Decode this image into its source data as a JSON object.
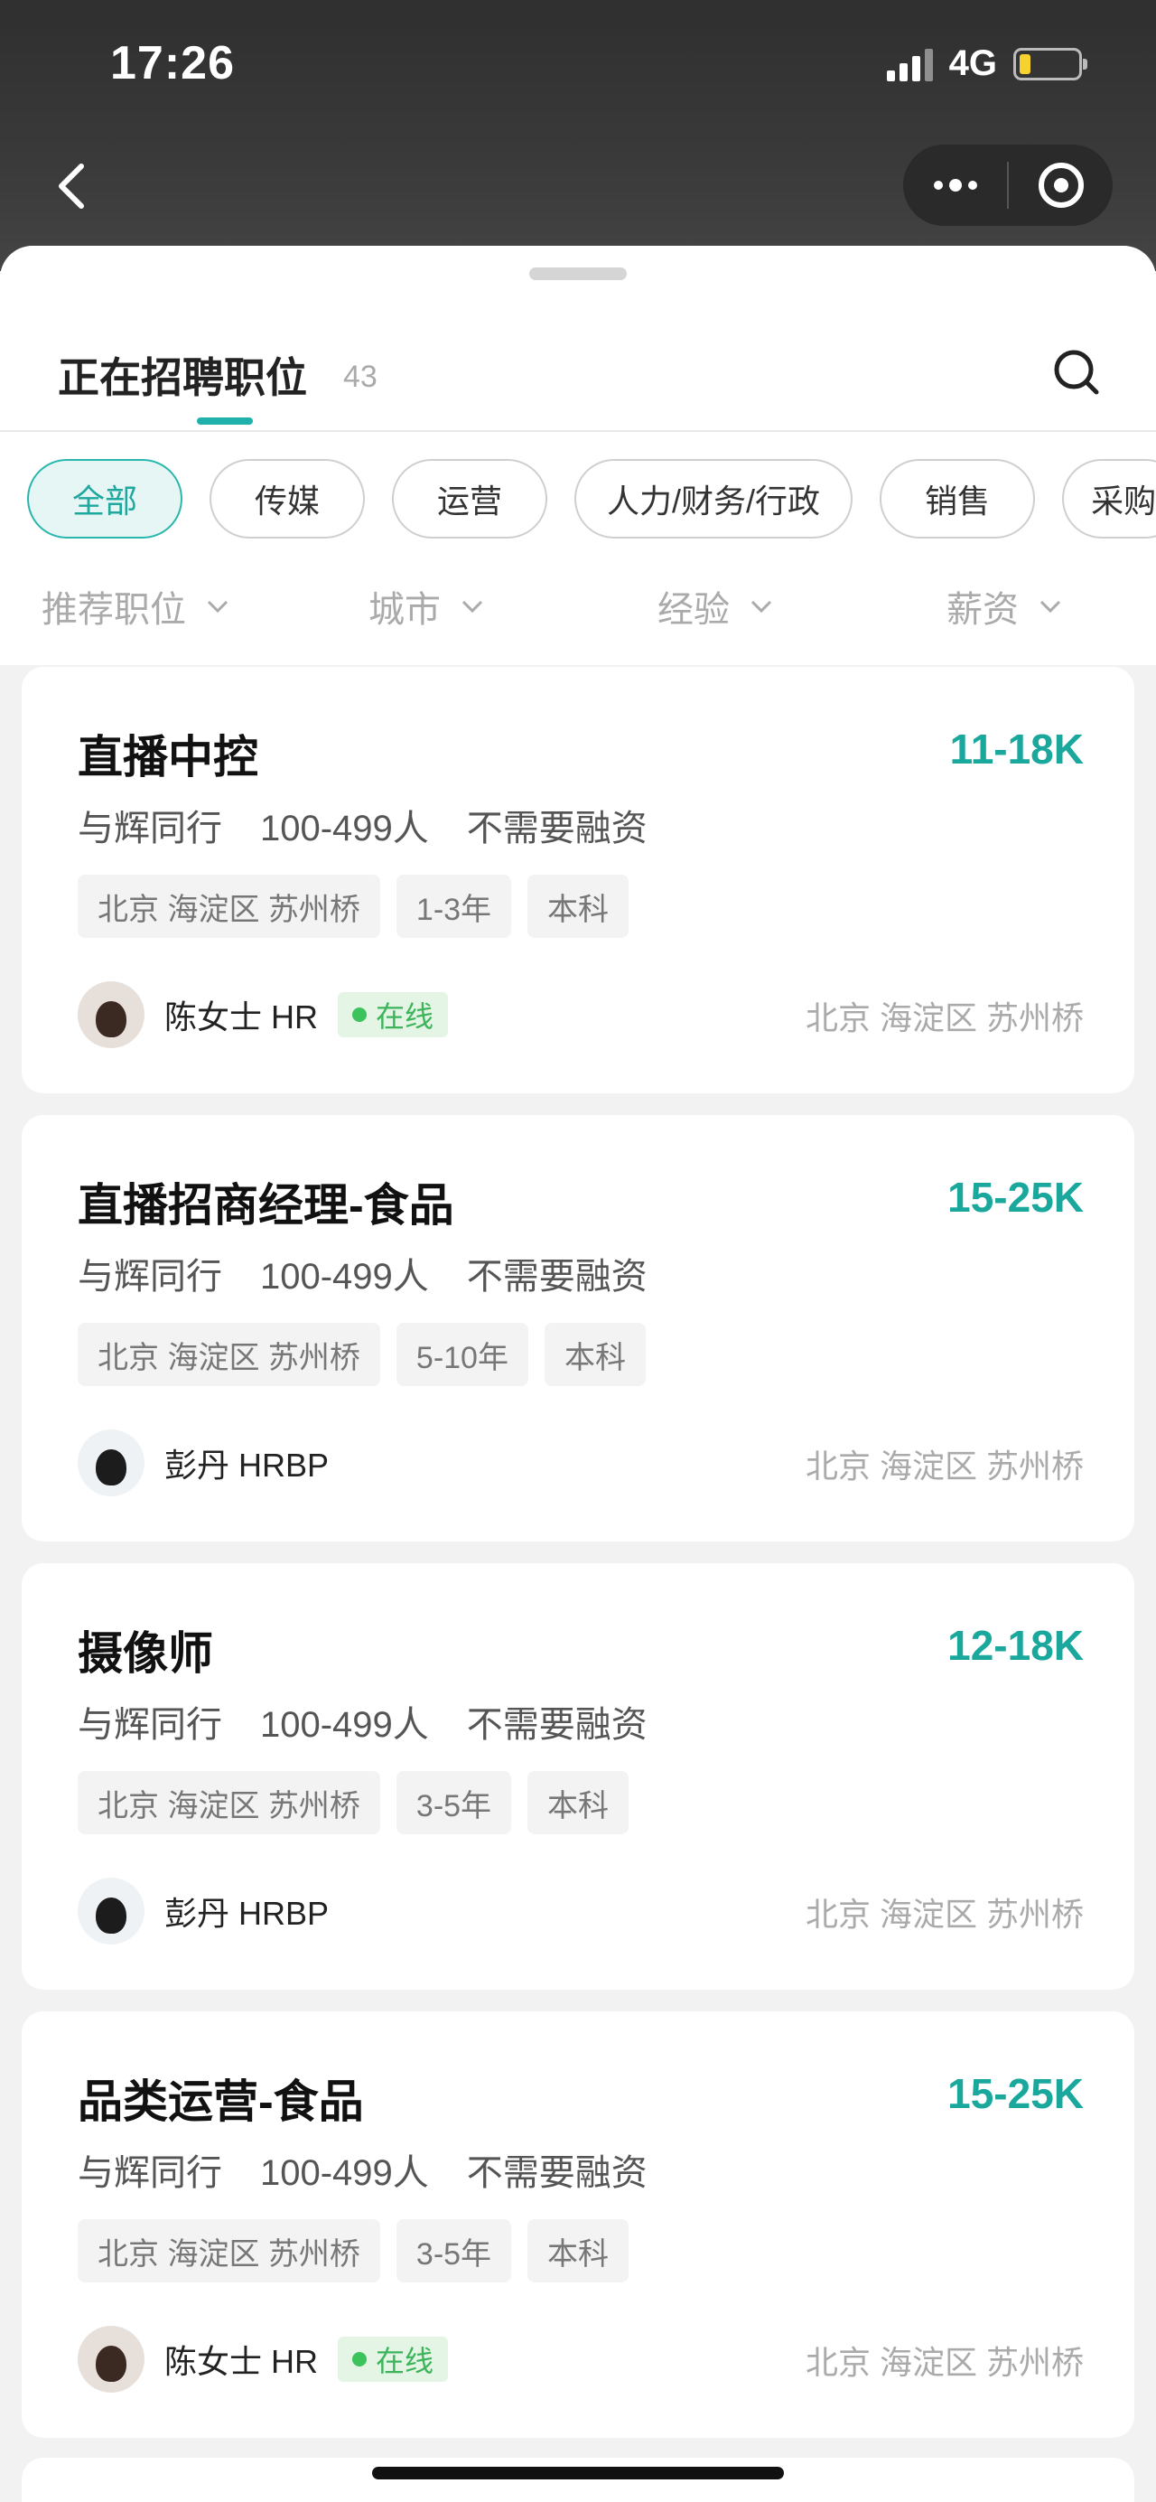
{
  "status_bar": {
    "time": "17:26",
    "network": "4G",
    "battery_level": 0.2
  },
  "header": {
    "title": "正在招聘职位",
    "count": "43"
  },
  "categories": {
    "items": [
      "全部",
      "传媒",
      "运营",
      "人力/财务/行政",
      "销售",
      "采购"
    ],
    "active_index": 0
  },
  "filters": [
    "推荐职位",
    "城市",
    "经验",
    "薪资"
  ],
  "jobs": [
    {
      "title": "直播中控",
      "salary": "11-18K",
      "company": "与辉同行",
      "size": "100-499人",
      "funding": "不需要融资",
      "tags": [
        "北京 海淀区 苏州桥",
        "1-3年",
        "本科"
      ],
      "recruiter": "陈女士 HR",
      "online": "在线",
      "location": "北京 海淀区 苏州桥"
    },
    {
      "title": "直播招商经理-食品",
      "salary": "15-25K",
      "company": "与辉同行",
      "size": "100-499人",
      "funding": "不需要融资",
      "tags": [
        "北京 海淀区 苏州桥",
        "5-10年",
        "本科"
      ],
      "recruiter": "彭丹 HRBP",
      "online": "",
      "location": "北京 海淀区 苏州桥"
    },
    {
      "title": "摄像师",
      "salary": "12-18K",
      "company": "与辉同行",
      "size": "100-499人",
      "funding": "不需要融资",
      "tags": [
        "北京 海淀区 苏州桥",
        "3-5年",
        "本科"
      ],
      "recruiter": "彭丹 HRBP",
      "online": "",
      "location": "北京 海淀区 苏州桥"
    },
    {
      "title": "品类运营-食品",
      "salary": "15-25K",
      "company": "与辉同行",
      "size": "100-499人",
      "funding": "不需要融资",
      "tags": [
        "北京 海淀区 苏州桥",
        "3-5年",
        "本科"
      ],
      "recruiter": "陈女士 HR",
      "online": "在线",
      "location": "北京 海淀区 苏州桥"
    }
  ],
  "colors": {
    "accent": "#1aa79c",
    "online_green": "#3cb55a"
  }
}
